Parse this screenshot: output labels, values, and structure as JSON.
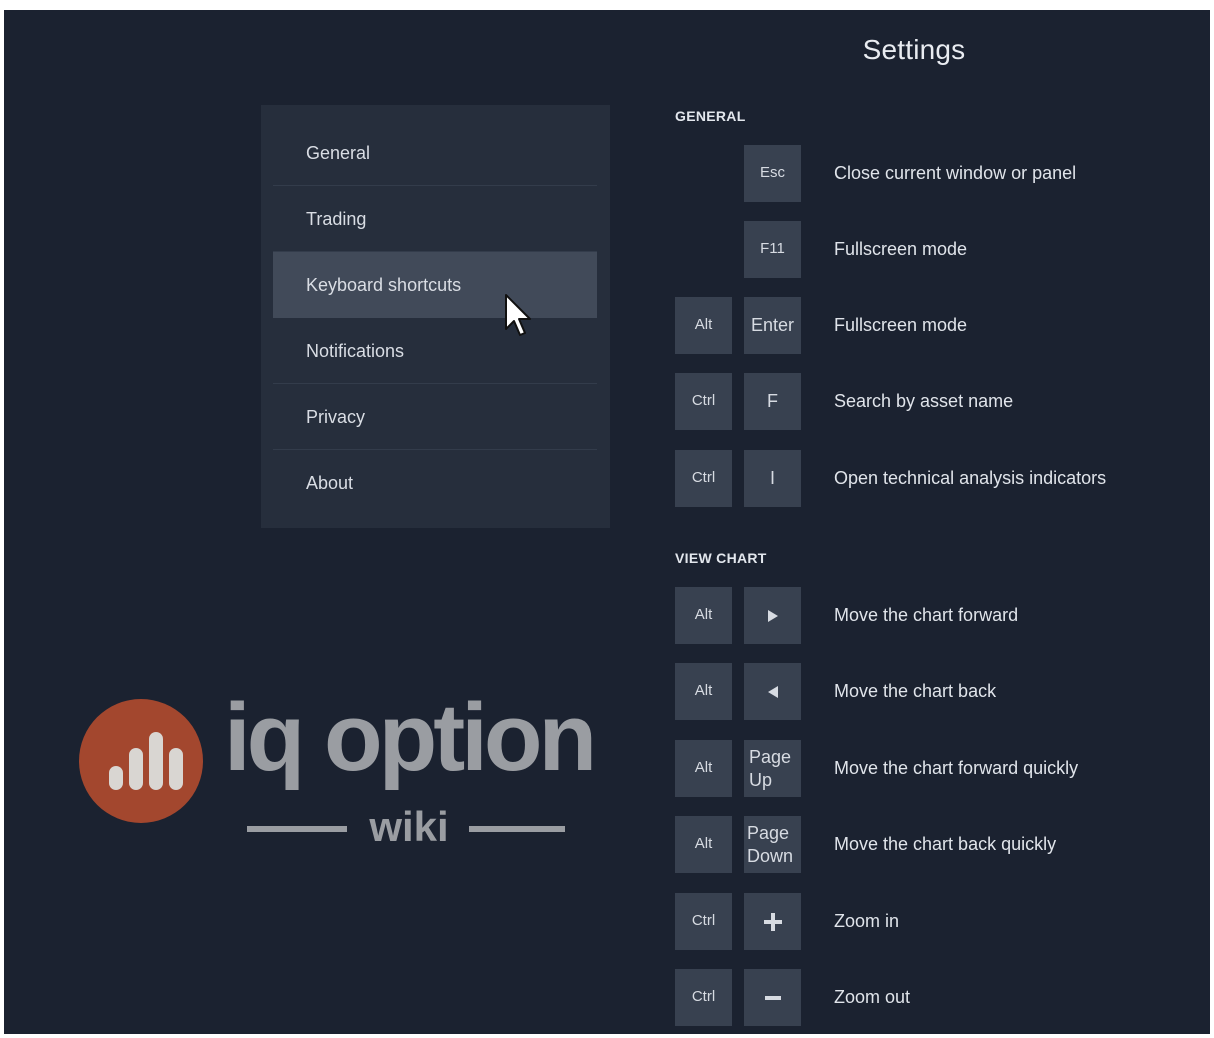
{
  "header": {
    "title": "Settings"
  },
  "menu": {
    "items": [
      {
        "label": "General",
        "active": false
      },
      {
        "label": "Trading",
        "active": false
      },
      {
        "label": "Keyboard shortcuts",
        "active": true
      },
      {
        "label": "Notifications",
        "active": false
      },
      {
        "label": "Privacy",
        "active": false
      },
      {
        "label": "About",
        "active": false
      }
    ]
  },
  "sections": {
    "general": {
      "title": "GENERAL",
      "shortcuts": [
        {
          "keys": [
            "Esc"
          ],
          "description": "Close current window or panel"
        },
        {
          "keys": [
            "F11"
          ],
          "description": "Fullscreen mode"
        },
        {
          "keys": [
            "Alt",
            "Enter"
          ],
          "description": "Fullscreen mode"
        },
        {
          "keys": [
            "Ctrl",
            "F"
          ],
          "description": "Search by asset name"
        },
        {
          "keys": [
            "Ctrl",
            "I"
          ],
          "description": "Open technical analysis indicators"
        }
      ]
    },
    "view_chart": {
      "title": "VIEW CHART",
      "shortcuts": [
        {
          "keys": [
            "Alt",
            "arrow-right-icon"
          ],
          "description": "Move the chart forward"
        },
        {
          "keys": [
            "Alt",
            "arrow-left-icon"
          ],
          "description": "Move the chart back"
        },
        {
          "keys": [
            "Alt",
            "Page Up"
          ],
          "description": "Move the chart forward quickly"
        },
        {
          "keys": [
            "Alt",
            "Page Down"
          ],
          "description": "Move the chart back quickly"
        },
        {
          "keys": [
            "Ctrl",
            "plus-icon"
          ],
          "description": "Zoom in"
        },
        {
          "keys": [
            "Ctrl",
            "minus-icon"
          ],
          "description": "Zoom out"
        }
      ]
    }
  },
  "watermark": {
    "brand": "iq option",
    "sub": "wiki",
    "circle_color": "#a3472e"
  },
  "colors": {
    "background": "#1b2230",
    "panel": "#262e3c",
    "active_item": "#414a59",
    "key": "#384150"
  }
}
